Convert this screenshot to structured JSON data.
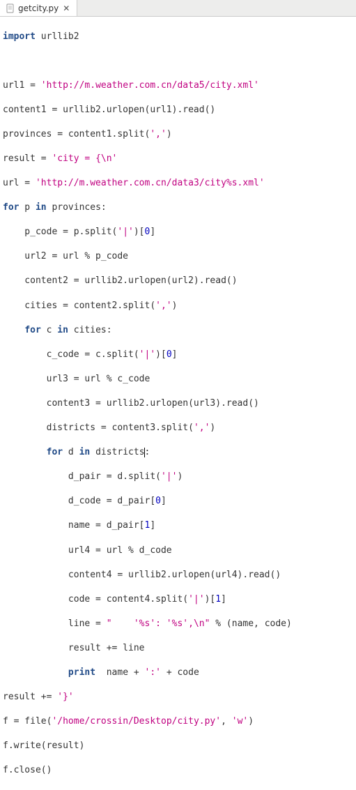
{
  "tab": {
    "filename": "getcity.py",
    "close_glyph": "✕"
  },
  "code": {
    "l01_import": "import",
    "l01_mod": "urllib2",
    "l03_lhs": "url1 = ",
    "l03_str": "'http://m.weather.com.cn/data5/city.xml'",
    "l04": "content1 = urllib2.urlopen(url1).read()",
    "l05_a": "provinces = content1.split(",
    "l05_str": "','",
    "l05_b": ")",
    "l06_a": "result = ",
    "l06_str": "'city = {\\n'",
    "l07_a": "url = ",
    "l07_str": "'http://m.weather.com.cn/data3/city%s.xml'",
    "l08_for": "for",
    "l08_var": " p ",
    "l08_in": "in",
    "l08_rest": " provinces:",
    "l09_a": "    p_code = p.split(",
    "l09_str": "'|'",
    "l09_b": ")[",
    "l09_n": "0",
    "l09_c": "]",
    "l10": "    url2 = url % p_code",
    "l11": "    content2 = urllib2.urlopen(url2).read()",
    "l12_a": "    cities = content2.split(",
    "l12_str": "','",
    "l12_b": ")",
    "l13_pad": "    ",
    "l13_for": "for",
    "l13_var": " c ",
    "l13_in": "in",
    "l13_rest": " cities:",
    "l14_a": "        c_code = c.split(",
    "l14_str": "'|'",
    "l14_b": ")[",
    "l14_n": "0",
    "l14_c": "]",
    "l15": "        url3 = url % c_code",
    "l16": "        content3 = urllib2.urlopen(url3).read()",
    "l17_a": "        districts = content3.split(",
    "l17_str": "','",
    "l17_b": ")",
    "l18_pad": "        ",
    "l18_for": "for",
    "l18_var": " d ",
    "l18_in": "in",
    "l18_rest": " districts",
    "l18_colon": ":",
    "l19_a": "            d_pair = d.split(",
    "l19_str": "'|'",
    "l19_b": ")",
    "l20_a": "            d_code = d_pair[",
    "l20_n": "0",
    "l20_b": "]",
    "l21_a": "            name = d_pair[",
    "l21_n": "1",
    "l21_b": "]",
    "l22": "            url4 = url % d_code",
    "l23": "            content4 = urllib2.urlopen(url4).read()",
    "l24_a": "            code = content4.split(",
    "l24_str": "'|'",
    "l24_b": ")[",
    "l24_n": "1",
    "l24_c": "]",
    "l25_a": "            line = ",
    "l25_str": "\"    '%s': '%s',\\n\"",
    "l25_b": " % (name, code)",
    "l26": "            result += line",
    "l27_pad": "            ",
    "l27_print": "print",
    "l27_a": "  name + ",
    "l27_str": "':'",
    "l27_b": " + code",
    "l28_a": "result += ",
    "l28_str": "'}'",
    "l29_a": "f = file(",
    "l29_str": "'/home/crossin/Desktop/city.py'",
    "l29_b": ", ",
    "l29_str2": "'w'",
    "l29_c": ")",
    "l30": "f.write(result)",
    "l31": "f.close()"
  }
}
